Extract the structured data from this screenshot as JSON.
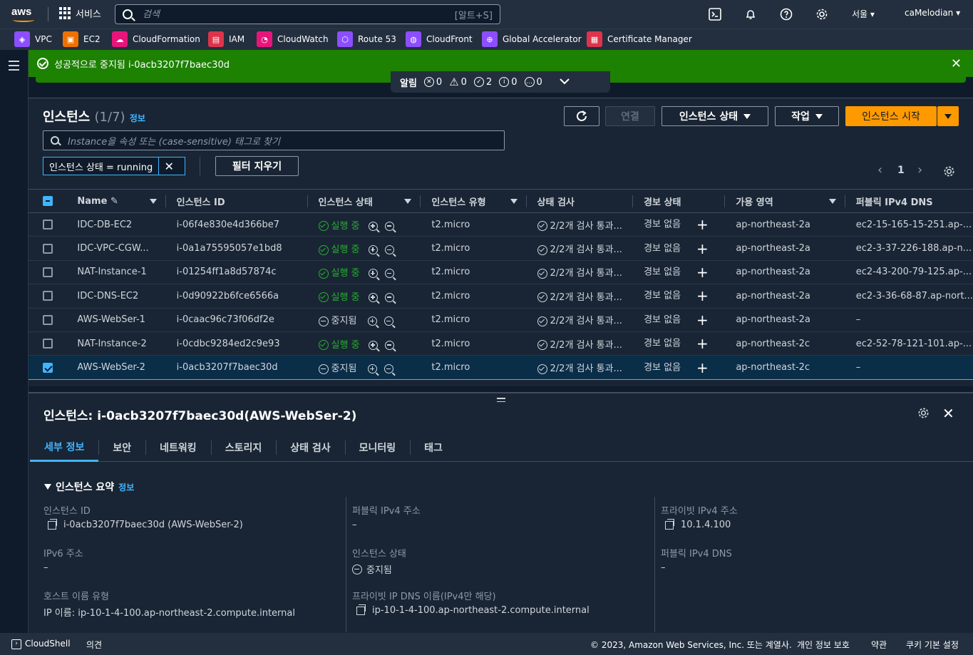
{
  "topbar": {
    "logo": "aws",
    "services_label": "서비스",
    "search_placeholder": "검색",
    "search_shortcut": "[알트+S]",
    "region": "서울",
    "account": "caMelodian"
  },
  "favorites": [
    {
      "label": "VPC",
      "icon": "vpc-icon",
      "color": "#8c4fff"
    },
    {
      "label": "EC2",
      "icon": "ec2-icon",
      "color": "#ed7100"
    },
    {
      "label": "CloudFormation",
      "icon": "cloudformation-icon",
      "color": "#e7157b"
    },
    {
      "label": "IAM",
      "icon": "iam-icon",
      "color": "#dd344c"
    },
    {
      "label": "CloudWatch",
      "icon": "cloudwatch-icon",
      "color": "#e7157b"
    },
    {
      "label": "Route 53",
      "icon": "route53-icon",
      "color": "#8c4fff"
    },
    {
      "label": "CloudFront",
      "icon": "cloudfront-icon",
      "color": "#8c4fff"
    },
    {
      "label": "Global Accelerator",
      "icon": "global-accelerator-icon",
      "color": "#8c4fff"
    },
    {
      "label": "Certificate Manager",
      "icon": "certificate-manager-icon",
      "color": "#dd344c"
    }
  ],
  "flash": {
    "message": "성공적으로 중지됨 i-0acb3207f7baec30d"
  },
  "notifications": {
    "label": "알림",
    "error": "0",
    "warning": "0",
    "success": "2",
    "info": "0",
    "in_progress": "0"
  },
  "instances": {
    "title": "인스턴스",
    "count": "(1/7)",
    "info": "정보",
    "connect_label": "연결",
    "state_label": "인스턴스 상태",
    "actions_label": "작업",
    "launch_label": "인스턴스 시작",
    "filter_placeholder": "Instance을 속성 또는 (case-sensitive) 태그로 찾기",
    "filter_token": "인스턴스 상태 = running",
    "clear_filters": "필터 지우기",
    "page": "1",
    "columns": {
      "name": "Name",
      "id": "인스턴스 ID",
      "state": "인스턴스 상태",
      "type": "인스턴스 유형",
      "check": "상태 검사",
      "alarm": "경보 상태",
      "az": "가용 영역",
      "dns": "퍼블릭 IPv4 DNS"
    },
    "rows": [
      {
        "name": "IDC-DB-EC2",
        "id": "i-06f4e830e4d366be7",
        "state": "실행 중",
        "running": true,
        "type": "t2.micro",
        "check": "2/2개 검사 통과...",
        "alarm": "경보 없음",
        "az": "ap-northeast-2a",
        "dns": "ec2-15-165-15-251.ap-...",
        "selected": false
      },
      {
        "name": "IDC-VPC-CGW...",
        "id": "i-0a1a75595057e1bd8",
        "state": "실행 중",
        "running": true,
        "type": "t2.micro",
        "check": "2/2개 검사 통과...",
        "alarm": "경보 없음",
        "az": "ap-northeast-2a",
        "dns": "ec2-3-37-226-188.ap-n...",
        "selected": false
      },
      {
        "name": "NAT-Instance-1",
        "id": "i-01254ff1a8d57874c",
        "state": "실행 중",
        "running": true,
        "type": "t2.micro",
        "check": "2/2개 검사 통과...",
        "alarm": "경보 없음",
        "az": "ap-northeast-2a",
        "dns": "ec2-43-200-79-125.ap-...",
        "selected": false
      },
      {
        "name": "IDC-DNS-EC2",
        "id": "i-0d90922b6fce6566a",
        "state": "실행 중",
        "running": true,
        "type": "t2.micro",
        "check": "2/2개 검사 통과...",
        "alarm": "경보 없음",
        "az": "ap-northeast-2a",
        "dns": "ec2-3-36-68-87.ap-nort...",
        "selected": false
      },
      {
        "name": "AWS-WebSer-1",
        "id": "i-0caac96c73f06df2e",
        "state": "중지됨",
        "running": false,
        "type": "t2.micro",
        "check": "2/2개 검사 통과...",
        "alarm": "경보 없음",
        "az": "ap-northeast-2a",
        "dns": "–",
        "selected": false
      },
      {
        "name": "NAT-Instance-2",
        "id": "i-0cdbc9284ed2c9e93",
        "state": "실행 중",
        "running": true,
        "type": "t2.micro",
        "check": "2/2개 검사 통과...",
        "alarm": "경보 없음",
        "az": "ap-northeast-2c",
        "dns": "ec2-52-78-121-101.ap-...",
        "selected": false
      },
      {
        "name": "AWS-WebSer-2",
        "id": "i-0acb3207f7baec30d",
        "state": "중지됨",
        "running": false,
        "type": "t2.micro",
        "check": "2/2개 검사 통과...",
        "alarm": "경보 없음",
        "az": "ap-northeast-2c",
        "dns": "–",
        "selected": true
      }
    ]
  },
  "details": {
    "title": "인스턴스: i-0acb3207f7baec30d(AWS-WebSer-2)",
    "tabs": [
      "세부 정보",
      "보안",
      "네트워킹",
      "스토리지",
      "상태 검사",
      "모니터링",
      "태그"
    ],
    "summary_title": "인스턴스 요약",
    "summary_info": "정보",
    "fields": {
      "instance_id_label": "인스턴스 ID",
      "instance_id_value": "i-0acb3207f7baec30d (AWS-WebSer-2)",
      "public_ipv4_label": "퍼블릭 IPv4 주소",
      "public_ipv4_value": "–",
      "private_ipv4_label": "프라이빗 IPv4 주소",
      "private_ipv4_value": "10.1.4.100",
      "ipv6_label": "IPv6 주소",
      "ipv6_value": "–",
      "state_label": "인스턴스 상태",
      "state_value": "중지됨",
      "public_dns_label": "퍼블릭 IPv4 DNS",
      "public_dns_value": "–",
      "hostname_type_label": "호스트 이름 유형",
      "hostname_type_value": "IP 이름: ip-10-1-4-100.ap-northeast-2.compute.internal",
      "private_dns_label": "프라이빗 IP DNS 이름(IPv4만 해당)",
      "private_dns_value": "ip-10-1-4-100.ap-northeast-2.compute.internal"
    }
  },
  "footer": {
    "cloudshell": "CloudShell",
    "feedback": "의견",
    "copyright": "© 2023, Amazon Web Services, Inc. 또는 계열사.",
    "privacy": "개인 정보 보호",
    "terms": "약관",
    "cookies": "쿠키 기본 설정"
  }
}
